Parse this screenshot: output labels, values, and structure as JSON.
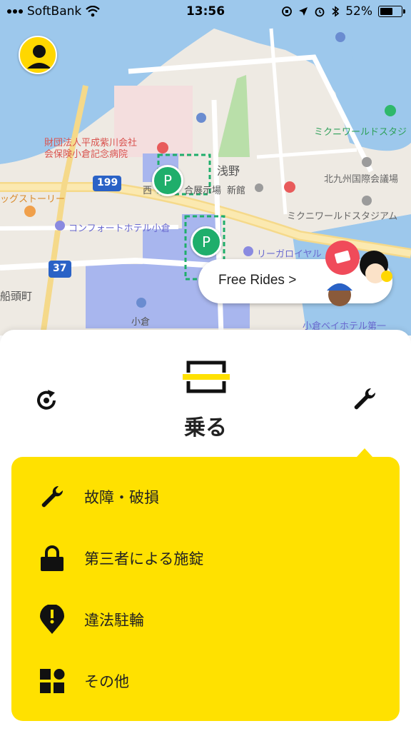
{
  "status_bar": {
    "carrier": "SoftBank",
    "time": "13:56",
    "battery": "52%",
    "battery_level": 0.52,
    "icons": [
      "signal-icon",
      "wifi-icon",
      "screen-lock-icon",
      "location-icon",
      "alarm-icon",
      "bluetooth-icon",
      "battery-icon"
    ]
  },
  "map": {
    "labels": {
      "hospital": "財団法人平成紫川会社\n会保険小倉記念病院",
      "asano": "浅野",
      "west_area": "西",
      "gouten": "合展示場",
      "shinkan": "新館",
      "kokusai": "北九州国際会議場",
      "mikuni1": "ミクニワールドスタジ",
      "mikuni2": "ミクニワールドスタジアム",
      "story": "ッグストーリー",
      "comfort": "コンフォートホテル小倉",
      "rihga": "リーガロイヤル",
      "funatou": "船頭町",
      "kokura": "小倉",
      "bayhotel": "小倉ベイホテル第一",
      "route199": "199",
      "route37": "37"
    },
    "parking_label": "P"
  },
  "free_rides": {
    "label": "Free Rides >"
  },
  "sheet": {
    "title": "乗る",
    "menu": [
      {
        "label": "故障・破損",
        "icon": "wrench-icon"
      },
      {
        "label": "第三者による施錠",
        "icon": "lock-icon"
      },
      {
        "label": "違法駐輪",
        "icon": "alert-pin-icon"
      },
      {
        "label": "その他",
        "icon": "grid-icon"
      }
    ]
  },
  "colors": {
    "accent_yellow": "#ffe100",
    "parking_green": "#1fae6b",
    "water_blue": "#9dc8ec",
    "route_blue": "#2a62c6"
  }
}
